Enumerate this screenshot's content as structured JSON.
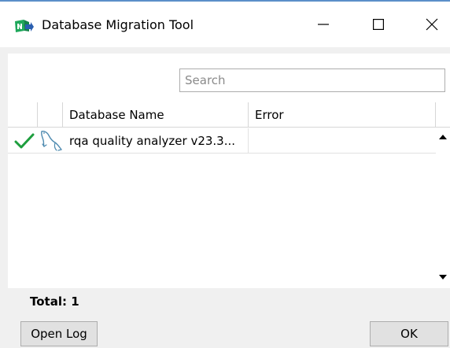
{
  "window": {
    "title": "Database Migration Tool",
    "app_icon": "database-migration-app-icon",
    "controls": [
      "minimize-icon",
      "maximize-icon",
      "close-icon"
    ]
  },
  "search": {
    "placeholder": "Search",
    "value": ""
  },
  "grid": {
    "columns": [
      "",
      "",
      "Database Name",
      "Error"
    ],
    "rows": [
      {
        "status_icon": "check-icon",
        "type_icon": "mysql-dolphin-icon",
        "name": "rqa quality analyzer v23.3...",
        "error": ""
      }
    ],
    "scroll_icons": [
      "scroll-up-arrow-icon",
      "scroll-down-arrow-icon"
    ]
  },
  "footer": {
    "total_label": "Total: 1",
    "open_log_label": "Open Log",
    "ok_label": "OK"
  },
  "colors": {
    "accent": "#5b8fc9",
    "check": "#1e9e3e",
    "dolphin": "#4f8bb0",
    "icon_green": "#1fa85b"
  }
}
